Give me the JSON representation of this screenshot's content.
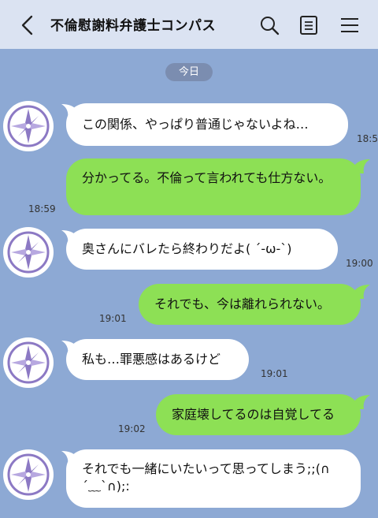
{
  "header": {
    "title": "不倫慰謝料弁護士コンパス",
    "back_icon": "chevron-left-icon",
    "search_icon": "search-icon",
    "notes_icon": "notes-icon",
    "menu_icon": "menu-icon"
  },
  "date_label": "今日",
  "messages": [
    {
      "side": "left",
      "text": "この関係、やっぱり普通じゃないよね…",
      "time": "18:5"
    },
    {
      "side": "right",
      "text": "分かってる。不倫って言われても仕方ない。",
      "time": "18:59"
    },
    {
      "side": "left",
      "text": "奥さんにバレたら終わりだよ( ´-ω-`)",
      "time": "19:00"
    },
    {
      "side": "right",
      "text": "それでも、今は離れられない。",
      "time": "19:01"
    },
    {
      "side": "left",
      "text": "私も…罪悪感はあるけど",
      "time": "19:01"
    },
    {
      "side": "right",
      "text": "家庭壊してるのは自覚してる",
      "time": "19:02"
    },
    {
      "side": "left",
      "text": "それでも一緒にいたいって思ってしまう;;(∩´﹏`∩);:",
      "time": ""
    }
  ],
  "colors": {
    "background": "#8da9d4",
    "header": "#dbe3f2",
    "left_bubble": "#ffffff",
    "right_bubble": "#8de055",
    "date_pill": "#7b8db0",
    "avatar_accent": "#8c79c4"
  }
}
